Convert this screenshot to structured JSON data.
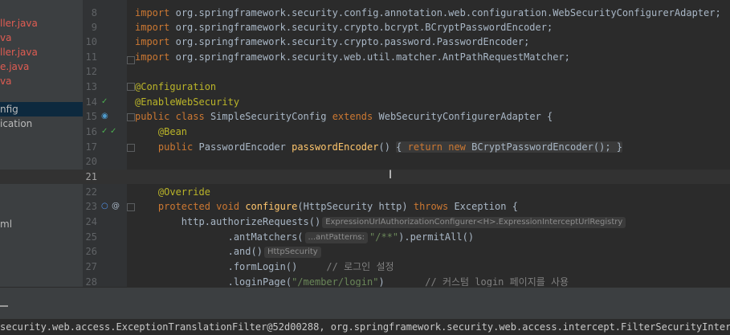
{
  "sidebar": {
    "items": [
      {
        "label": "ller.java",
        "style": "red"
      },
      {
        "label": "va",
        "style": "red"
      },
      {
        "label": "ller.java",
        "style": "red"
      },
      {
        "label": "e.java",
        "style": "red"
      },
      {
        "label": "va",
        "style": "red"
      },
      {
        "label": "nfig",
        "style": "selected"
      },
      {
        "label": "ication",
        "style": "normal"
      },
      {
        "label": "ml",
        "style": "normal"
      }
    ]
  },
  "editor": {
    "lines": [
      {
        "n": "8"
      },
      {
        "n": "9"
      },
      {
        "n": "10"
      },
      {
        "n": "11"
      },
      {
        "n": "12"
      },
      {
        "n": "13"
      },
      {
        "n": "14"
      },
      {
        "n": "15"
      },
      {
        "n": "16"
      },
      {
        "n": "17"
      },
      {
        "n": "20"
      },
      {
        "n": "21"
      },
      {
        "n": "22"
      },
      {
        "n": "23"
      },
      {
        "n": "24"
      },
      {
        "n": "25"
      },
      {
        "n": "26"
      },
      {
        "n": "27"
      },
      {
        "n": "28"
      }
    ],
    "tokens": {
      "import": "import",
      "imp8": "org.springframework.security.config.annotation.web.configuration.WebSecurityConfigurerAdapter;",
      "imp9": "org.springframework.security.crypto.bcrypt.BCryptPasswordEncoder;",
      "imp10": "org.springframework.security.crypto.password.PasswordEncoder;",
      "imp11": "org.springframework.security.web.util.matcher.AntPathRequestMatcher;",
      "ann_config": "@Configuration",
      "ann_websec": "@EnableWebSecurity",
      "kw_public": "public",
      "kw_class": "class",
      "cls_name": "SimpleSecurityConfig",
      "kw_extends": "extends",
      "super_name": "WebSecurityConfigurerAdapter {",
      "ann_bean": "@Bean",
      "type_pe": "PasswordEncoder",
      "fn_pe": "passwordEncoder",
      "paren": "()",
      "brace_open": "{",
      "kw_return": "return",
      "kw_new": "new",
      "bcrypt_call": "BCryptPasswordEncoder();",
      "brace_close": "}",
      "ann_override": "@Override",
      "kw_protected": "protected",
      "kw_void": "void",
      "fn_configure": "configure",
      "params": "(HttpSecurity http)",
      "kw_throws": "throws",
      "exception": "Exception {",
      "authorize": "http.authorizeRequests()",
      "hint_registry": "ExpressionUrlAuthorizationConfigurer<H>.ExpressionInterceptUrlRegistry",
      "antmatchers": ".antMatchers(",
      "hint_antpatterns": "...antPatterns:",
      "str_all": "\"/**\"",
      "permitall": ").permitAll()",
      "and": ".and()",
      "hint_httpsecurity": "HttpSecurity",
      "formlogin": ".formLogin()",
      "cmt_login": "// 로그인 설정",
      "loginpage": ".loginPage(",
      "str_login": "\"/member/login\"",
      "close_paren": ")",
      "cmt_custom": "// 커스텀 login 페이지를 사용"
    }
  },
  "console": {
    "text": "security.web.access.ExceptionTranslationFilter@52d00288, org.springframework.security.web.access.intercept.FilterSecurityInterce"
  },
  "colors": {
    "keyword": "#cc7832",
    "annotation": "#bbb529",
    "function": "#ffc66d",
    "string": "#6a8759",
    "comment": "#808080"
  }
}
